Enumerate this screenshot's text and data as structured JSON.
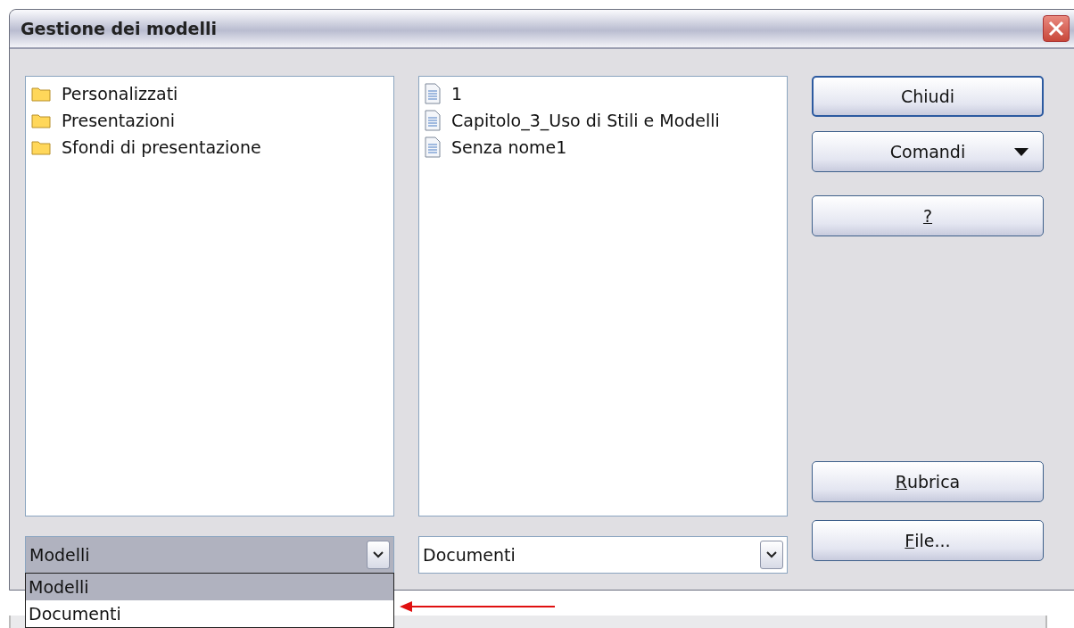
{
  "window": {
    "title": "Gestione dei modelli"
  },
  "left_list": {
    "items": [
      {
        "kind": "folder",
        "label": "Personalizzati"
      },
      {
        "kind": "folder",
        "label": "Presentazioni"
      },
      {
        "kind": "folder",
        "label": "Sfondi di presentazione"
      }
    ]
  },
  "right_list": {
    "items": [
      {
        "kind": "document",
        "label": "1"
      },
      {
        "kind": "document",
        "label": "Capitolo_3_Uso di Stili e Modelli"
      },
      {
        "kind": "document",
        "label": "Senza nome1"
      }
    ]
  },
  "buttons": [
    {
      "label": "Chiudi",
      "kind": "default",
      "underline_first": false
    },
    {
      "label": "Comandi",
      "kind": "menu",
      "underline_first": false
    },
    {
      "label": "?",
      "kind": "plain",
      "underline_first": true
    },
    {
      "label": "Rubrica",
      "kind": "plain",
      "underline_first": true
    },
    {
      "label": "File...",
      "kind": "plain",
      "underline_first": true
    }
  ],
  "left_combo": {
    "value": "Modelli",
    "expanded": true,
    "options": [
      {
        "label": "Modelli",
        "selected": true
      },
      {
        "label": "Documenti",
        "selected": false
      }
    ]
  },
  "right_combo": {
    "value": "Documenti",
    "expanded": false
  }
}
